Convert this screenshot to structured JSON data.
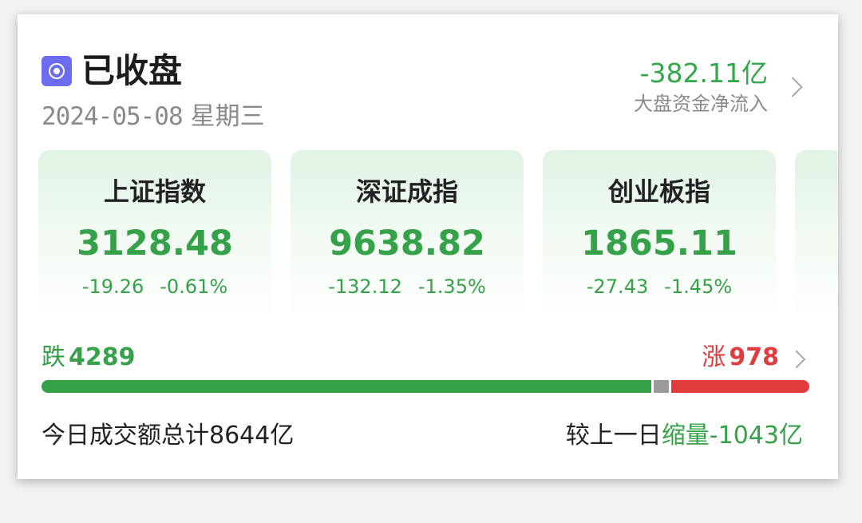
{
  "header": {
    "status": "已收盘",
    "status_icon": "stop-circle-icon",
    "date": "2024-05-08",
    "weekday": "星期三",
    "net_flow_value": "-382.11亿",
    "net_flow_label": "大盘资金净流入"
  },
  "indices": [
    {
      "name": "上证指数",
      "value": "3128.48",
      "change": "-19.26",
      "change_pct": "-0.61%"
    },
    {
      "name": "深证成指",
      "value": "9638.82",
      "change": "-132.12",
      "change_pct": "-1.35%"
    },
    {
      "name": "创业板指",
      "value": "1865.11",
      "change": "-27.43",
      "change_pct": "-1.45%"
    }
  ],
  "breadth": {
    "fall_label": "跌",
    "fall_count": 4289,
    "rise_label": "涨",
    "rise_count": 978,
    "fall_share": 0.794,
    "flat_share": 0.02,
    "rise_share": 0.181
  },
  "footer": {
    "turnover": "今日成交额总计8644亿",
    "compare_prefix": "较上一日",
    "compare_value": "缩量-1043亿"
  },
  "colors": {
    "down": "#35a148",
    "up": "#e23b3b",
    "flat": "#9a9a9a",
    "icon_bg": "#6b6cf0"
  }
}
